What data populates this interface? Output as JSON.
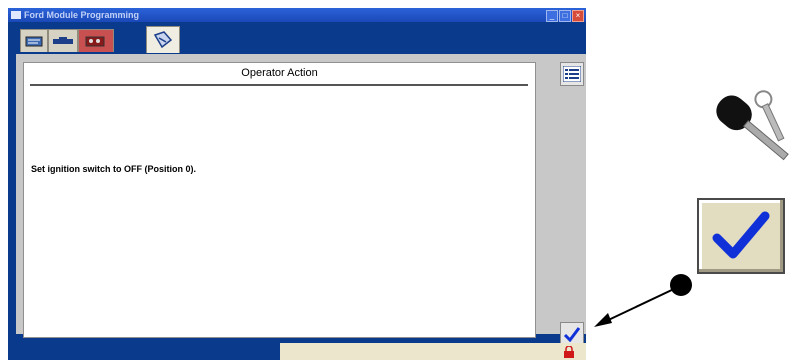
{
  "window": {
    "title": "Ford Module Programming",
    "tabs": [
      {
        "icon": "vehicle-info-icon"
      },
      {
        "icon": "toolbox-icon"
      },
      {
        "icon": "module-icon"
      },
      {
        "icon": "programming-tab-icon"
      }
    ]
  },
  "panel": {
    "title": "Operator Action",
    "message": "Set ignition switch to OFF (Position 0)."
  },
  "side_buttons": {
    "list_icon": "list-icon",
    "confirm_icon": "checkmark-icon"
  },
  "callout": {
    "keys_icon": "ignition-keys-icon",
    "confirm_icon": "checkmark-icon"
  },
  "colors": {
    "window_blue": "#0a3a8c",
    "check_blue": "#1030d8"
  }
}
